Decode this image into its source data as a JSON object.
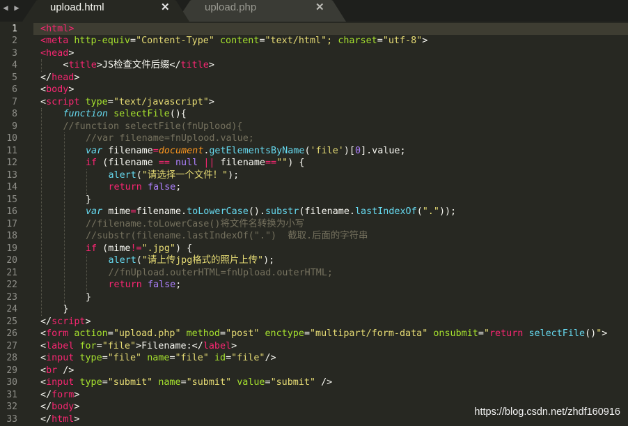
{
  "nav": {
    "left": "◀",
    "right": "▶"
  },
  "tabs": [
    {
      "label": "upload.html",
      "active": true,
      "close": "✕"
    },
    {
      "label": "upload.php",
      "active": false,
      "close": "✕"
    }
  ],
  "theme": {
    "background": "#272822",
    "tag": "#f92672",
    "attribute": "#a6e22e",
    "string": "#e6db74",
    "keyword": "#66d9ef",
    "comment": "#75715e",
    "number": "#ae81ff",
    "text": "#f8f8f2"
  },
  "editor": {
    "active_line": 1,
    "lines": [
      {
        "n": "1",
        "indent": 0,
        "tokens": [
          [
            "t",
            "<"
          ],
          [
            "t",
            "html"
          ],
          [
            "t",
            ">"
          ]
        ]
      },
      {
        "n": "2",
        "indent": 0,
        "tokens": [
          [
            "t",
            "<meta "
          ],
          [
            "a",
            "http-equiv"
          ],
          [
            "d",
            "="
          ],
          [
            "s",
            "\"Content-Type\""
          ],
          [
            "d",
            " "
          ],
          [
            "a",
            "content"
          ],
          [
            "d",
            "="
          ],
          [
            "s",
            "\"text/html\"; "
          ],
          [
            "a",
            "charset"
          ],
          [
            "d",
            "="
          ],
          [
            "s",
            "\"utf-8\""
          ],
          [
            "d",
            ">"
          ]
        ]
      },
      {
        "n": "3",
        "indent": 0,
        "tokens": [
          [
            "t",
            "<head"
          ],
          [
            "d",
            ">"
          ]
        ]
      },
      {
        "n": "4",
        "indent": 1,
        "tokens": [
          [
            "d",
            "<"
          ],
          [
            "t",
            "title"
          ],
          [
            "d",
            ">JS检查文件后缀</"
          ],
          [
            "t",
            "title"
          ],
          [
            "d",
            ">"
          ]
        ]
      },
      {
        "n": "5",
        "indent": 0,
        "tokens": [
          [
            "d",
            "</"
          ],
          [
            "t",
            "head"
          ],
          [
            "d",
            ">"
          ]
        ]
      },
      {
        "n": "6",
        "indent": 0,
        "tokens": [
          [
            "d",
            "<"
          ],
          [
            "t",
            "body"
          ],
          [
            "d",
            ">"
          ]
        ]
      },
      {
        "n": "7",
        "indent": 0,
        "tokens": [
          [
            "d",
            "<"
          ],
          [
            "t",
            "script"
          ],
          [
            "d",
            " "
          ],
          [
            "a",
            "type"
          ],
          [
            "d",
            "="
          ],
          [
            "s",
            "\"text/javascript\""
          ],
          [
            "d",
            ">"
          ]
        ]
      },
      {
        "n": "8",
        "indent": 1,
        "tokens": [
          [
            "k",
            "function"
          ],
          [
            "d",
            " "
          ],
          [
            "f",
            "selectFile"
          ],
          [
            "d",
            "(){"
          ]
        ]
      },
      {
        "n": "9",
        "indent": 1,
        "tokens": [
          [
            "c",
            "//function selectFile(fnUplood){"
          ]
        ]
      },
      {
        "n": "10",
        "indent": 2,
        "tokens": [
          [
            "c",
            "//var filename=fnUplood.value;"
          ]
        ]
      },
      {
        "n": "11",
        "indent": 2,
        "tokens": [
          [
            "k",
            "var"
          ],
          [
            "d",
            " filename"
          ],
          [
            "kw",
            "="
          ],
          [
            "v",
            "document"
          ],
          [
            "d",
            "."
          ],
          [
            "b",
            "getElementsByName"
          ],
          [
            "d",
            "("
          ],
          [
            "s",
            "'file'"
          ],
          [
            "d",
            ")["
          ],
          [
            "n",
            "0"
          ],
          [
            "d",
            "].value;"
          ]
        ]
      },
      {
        "n": "12",
        "indent": 2,
        "tokens": [
          [
            "kw",
            "if"
          ],
          [
            "d",
            " (filename "
          ],
          [
            "kw",
            "=="
          ],
          [
            "d",
            " "
          ],
          [
            "n",
            "null"
          ],
          [
            "d",
            " "
          ],
          [
            "kw",
            "||"
          ],
          [
            "d",
            " filename"
          ],
          [
            "kw",
            "=="
          ],
          [
            "s",
            "\"\""
          ],
          [
            "d",
            ") {"
          ]
        ]
      },
      {
        "n": "13",
        "indent": 3,
        "tokens": [
          [
            "b",
            "alert"
          ],
          [
            "d",
            "("
          ],
          [
            "s",
            "\"请选择一个文件！\""
          ],
          [
            "d",
            ");"
          ]
        ]
      },
      {
        "n": "14",
        "indent": 3,
        "tokens": [
          [
            "kw",
            "return"
          ],
          [
            "d",
            " "
          ],
          [
            "n",
            "false"
          ],
          [
            "d",
            ";"
          ]
        ]
      },
      {
        "n": "15",
        "indent": 2,
        "tokens": [
          [
            "d",
            "}"
          ]
        ]
      },
      {
        "n": "16",
        "indent": 2,
        "tokens": [
          [
            "k",
            "var"
          ],
          [
            "d",
            " mime"
          ],
          [
            "kw",
            "="
          ],
          [
            "d",
            "filename."
          ],
          [
            "b",
            "toLowerCase"
          ],
          [
            "d",
            "()."
          ],
          [
            "b",
            "substr"
          ],
          [
            "d",
            "(filename."
          ],
          [
            "b",
            "lastIndexOf"
          ],
          [
            "d",
            "("
          ],
          [
            "s",
            "\".\""
          ],
          [
            "d",
            "));"
          ]
        ]
      },
      {
        "n": "17",
        "indent": 2,
        "tokens": [
          [
            "c",
            "//filename.toLowerCase()将文件名转换为小写"
          ]
        ]
      },
      {
        "n": "18",
        "indent": 2,
        "tokens": [
          [
            "c",
            "//substr(filename.lastIndexOf(\".\")  截取.后面的字符串"
          ]
        ]
      },
      {
        "n": "19",
        "indent": 2,
        "tokens": [
          [
            "kw",
            "if"
          ],
          [
            "d",
            " (mime"
          ],
          [
            "kw",
            "!="
          ],
          [
            "s",
            "\".jpg\""
          ],
          [
            "d",
            ") {"
          ]
        ]
      },
      {
        "n": "20",
        "indent": 3,
        "tokens": [
          [
            "b",
            "alert"
          ],
          [
            "d",
            "("
          ],
          [
            "s",
            "\"请上传jpg格式的照片上传\""
          ],
          [
            "d",
            ");"
          ]
        ]
      },
      {
        "n": "21",
        "indent": 3,
        "tokens": [
          [
            "c",
            "//fnUpload.outerHTML=fnUpload.outerHTML;"
          ]
        ]
      },
      {
        "n": "22",
        "indent": 3,
        "tokens": [
          [
            "kw",
            "return"
          ],
          [
            "d",
            " "
          ],
          [
            "n",
            "false"
          ],
          [
            "d",
            ";"
          ]
        ]
      },
      {
        "n": "23",
        "indent": 2,
        "tokens": [
          [
            "d",
            "}"
          ]
        ]
      },
      {
        "n": "24",
        "indent": 1,
        "tokens": [
          [
            "d",
            "}"
          ]
        ]
      },
      {
        "n": "25",
        "indent": 0,
        "tokens": [
          [
            "d",
            "</"
          ],
          [
            "t",
            "script"
          ],
          [
            "d",
            ">"
          ]
        ]
      },
      {
        "n": "26",
        "indent": 0,
        "tokens": [
          [
            "d",
            "<"
          ],
          [
            "t",
            "form"
          ],
          [
            "d",
            " "
          ],
          [
            "a",
            "action"
          ],
          [
            "d",
            "="
          ],
          [
            "s",
            "\"upload.php\""
          ],
          [
            "d",
            " "
          ],
          [
            "a",
            "method"
          ],
          [
            "d",
            "="
          ],
          [
            "s",
            "\"post\""
          ],
          [
            "d",
            " "
          ],
          [
            "a",
            "enctype"
          ],
          [
            "d",
            "="
          ],
          [
            "s",
            "\"multipart/form-data\""
          ],
          [
            "d",
            " "
          ],
          [
            "a",
            "onsubmit"
          ],
          [
            "d",
            "="
          ],
          [
            "s",
            "\""
          ],
          [
            "kw",
            "return"
          ],
          [
            "d",
            " "
          ],
          [
            "b",
            "selectFile"
          ],
          [
            "d",
            "()"
          ],
          [
            "s",
            "\""
          ],
          [
            "d",
            ">"
          ]
        ]
      },
      {
        "n": "27",
        "indent": 0,
        "tokens": [
          [
            "d",
            "<"
          ],
          [
            "t",
            "label"
          ],
          [
            "d",
            " "
          ],
          [
            "a",
            "for"
          ],
          [
            "d",
            "="
          ],
          [
            "s",
            "\"file\""
          ],
          [
            "d",
            ">Filename:</"
          ],
          [
            "t",
            "label"
          ],
          [
            "d",
            ">"
          ]
        ]
      },
      {
        "n": "28",
        "indent": 0,
        "tokens": [
          [
            "d",
            "<"
          ],
          [
            "t",
            "input"
          ],
          [
            "d",
            " "
          ],
          [
            "a",
            "type"
          ],
          [
            "d",
            "="
          ],
          [
            "s",
            "\"file\""
          ],
          [
            "d",
            " "
          ],
          [
            "a",
            "name"
          ],
          [
            "d",
            "="
          ],
          [
            "s",
            "\"file\""
          ],
          [
            "d",
            " "
          ],
          [
            "a",
            "id"
          ],
          [
            "d",
            "="
          ],
          [
            "s",
            "\"file\""
          ],
          [
            "d",
            "/>"
          ]
        ]
      },
      {
        "n": "29",
        "indent": 0,
        "tokens": [
          [
            "d",
            "<"
          ],
          [
            "t",
            "br"
          ],
          [
            "d",
            " />"
          ]
        ]
      },
      {
        "n": "30",
        "indent": 0,
        "tokens": [
          [
            "d",
            "<"
          ],
          [
            "t",
            "input"
          ],
          [
            "d",
            " "
          ],
          [
            "a",
            "type"
          ],
          [
            "d",
            "="
          ],
          [
            "s",
            "\"submit\""
          ],
          [
            "d",
            " "
          ],
          [
            "a",
            "name"
          ],
          [
            "d",
            "="
          ],
          [
            "s",
            "\"submit\""
          ],
          [
            "d",
            " "
          ],
          [
            "a",
            "value"
          ],
          [
            "d",
            "="
          ],
          [
            "s",
            "\"submit\""
          ],
          [
            "d",
            " />"
          ]
        ]
      },
      {
        "n": "31",
        "indent": 0,
        "tokens": [
          [
            "d",
            "</"
          ],
          [
            "t",
            "form"
          ],
          [
            "d",
            ">"
          ]
        ]
      },
      {
        "n": "32",
        "indent": 0,
        "tokens": [
          [
            "d",
            "</"
          ],
          [
            "t",
            "body"
          ],
          [
            "d",
            ">"
          ]
        ]
      },
      {
        "n": "33",
        "indent": 0,
        "tokens": [
          [
            "d",
            "</"
          ],
          [
            "t",
            "html"
          ],
          [
            "d",
            ">"
          ]
        ]
      }
    ]
  },
  "watermark": "https://blog.csdn.net/zhdf160916"
}
